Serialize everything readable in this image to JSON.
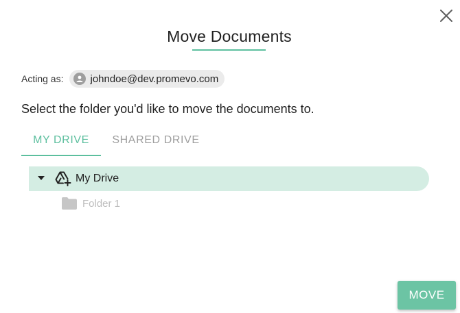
{
  "dialog": {
    "title": "Move Documents",
    "close_icon": "close-icon"
  },
  "acting": {
    "label": "Acting as:",
    "email": "johndoe@dev.promevo.com",
    "avatar_icon": "person-icon"
  },
  "instruction": "Select the folder you'd like to move the documents to.",
  "tabs": [
    {
      "label": "MY DRIVE",
      "active": true
    },
    {
      "label": "SHARED DRIVE",
      "active": false
    }
  ],
  "tree": {
    "root": {
      "label": "My Drive",
      "icon": "add-to-drive-icon",
      "expanded": true,
      "selected": true
    },
    "children": [
      {
        "label": "Folder 1",
        "icon": "folder-icon",
        "disabled": true
      }
    ]
  },
  "actions": {
    "move_label": "MOVE"
  },
  "colors": {
    "accent": "#5cbf9e",
    "selected_row": "#d4ede3",
    "button": "#6cc4a4"
  }
}
